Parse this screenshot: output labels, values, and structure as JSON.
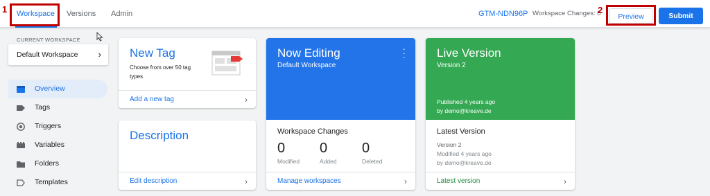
{
  "header": {
    "tabs": [
      {
        "label": "Workspace",
        "active": true
      },
      {
        "label": "Versions",
        "active": false
      },
      {
        "label": "Admin",
        "active": false
      }
    ],
    "container_id": "GTM-NDN96P",
    "workspace_changes": "Workspace Changes: 0",
    "preview_label": "Preview",
    "submit_label": "Submit",
    "annotations": [
      "1",
      "2"
    ]
  },
  "sidebar": {
    "current_workspace_label": "CURRENT WORKSPACE",
    "workspace_name": "Default Workspace",
    "items": [
      {
        "label": "Overview",
        "icon": "overview-icon",
        "active": true
      },
      {
        "label": "Tags",
        "icon": "tag-icon",
        "active": false
      },
      {
        "label": "Triggers",
        "icon": "trigger-icon",
        "active": false
      },
      {
        "label": "Variables",
        "icon": "variables-icon",
        "active": false
      },
      {
        "label": "Folders",
        "icon": "folder-icon",
        "active": false
      },
      {
        "label": "Templates",
        "icon": "template-icon",
        "active": false
      }
    ]
  },
  "cards": {
    "new_tag": {
      "title": "New Tag",
      "description": "Choose from over 50 tag types",
      "link": "Add a new tag"
    },
    "description": {
      "title": "Description",
      "link": "Edit description"
    },
    "now_editing": {
      "title": "Now Editing",
      "subtitle": "Default Workspace",
      "changes_title": "Workspace Changes",
      "stats": [
        {
          "value": "0",
          "label": "Modified"
        },
        {
          "value": "0",
          "label": "Added"
        },
        {
          "value": "0",
          "label": "Deleted"
        }
      ],
      "link": "Manage workspaces"
    },
    "live_version": {
      "title": "Live Version",
      "subtitle": "Version 2",
      "published": "Published 4 years ago",
      "published_by": "by demo@kreave.de",
      "latest_title": "Latest Version",
      "latest_name": "Version 2",
      "latest_modified": "Modified 4 years ago",
      "latest_by": "by demo@kreave.de",
      "link": "Latest version"
    }
  },
  "colors": {
    "accent": "#1a73e8",
    "editing_bg": "#2374e8",
    "live_bg": "#34a853",
    "annotation": "#c00000"
  }
}
